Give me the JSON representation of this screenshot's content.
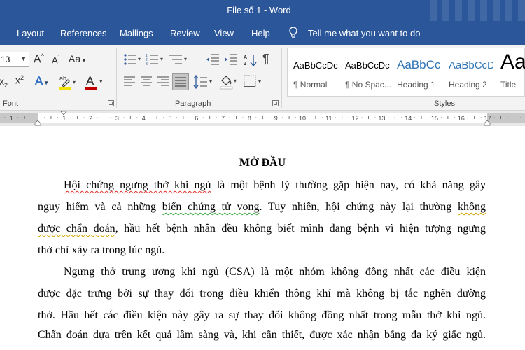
{
  "window": {
    "title": "File số 1  -  Word"
  },
  "tabs": [
    "Layout",
    "References",
    "Mailings",
    "Review",
    "View",
    "Help"
  ],
  "tell_me": "Tell me what you want to do",
  "ribbon": {
    "font": {
      "size": "13",
      "grow_label": "A",
      "shrink_label": "A",
      "case_label": "Aa",
      "subscript_label": "x",
      "subscript_sub": "2",
      "superscript_label": "x",
      "superscript_sup": "2",
      "effects_label": "A",
      "font_color_label": "A",
      "group_label": "Font"
    },
    "paragraph": {
      "group_label": "Paragraph",
      "show_marks": "¶"
    },
    "styles": {
      "group_label": "Styles",
      "items": [
        {
          "sample": "AaBbCcDc",
          "name": "¶ Normal"
        },
        {
          "sample": "AaBbCcDc",
          "name": "¶ No Spac..."
        },
        {
          "sample": "AaBbCc",
          "name": "Heading 1"
        },
        {
          "sample": "AaBbCcD",
          "name": "Heading 2"
        },
        {
          "sample": "Aa",
          "name": "Title"
        }
      ]
    }
  },
  "ruler": {
    "numbers": [
      "1",
      "1",
      "2",
      "3",
      "4",
      "5",
      "6",
      "7",
      "8",
      "9",
      "10",
      "11",
      "12",
      "13",
      "14",
      "15",
      "16",
      "17"
    ]
  },
  "document": {
    "title": "MỞ ĐẦU",
    "p1": {
      "l1_err": "Hội chứng ngưng thở khi ngủ",
      "l1_rest": " là một bệnh lý thường gặp hiện nay, có khả năng gây",
      "l2_a": "nguy hiểm và cả những ",
      "l2_err": "biến chứng tử vong",
      "l2_b": ". Tuy nhiên, hội chứng này lại thường ",
      "l2_err2": "không",
      "l3_err": "được chẩn đoán",
      "l3_rest": ", hầu hết bệnh nhân đều không biết mình đang bệnh vì hiện tượng ngưng",
      "l4": "thở chỉ xảy ra trong lúc ngủ."
    },
    "p2": {
      "l1": "Ngưng thở trung ương khi ngủ (CSA) là một nhóm không đồng nhất các điều kiện",
      "l2": "được đặc trưng bởi sự thay đổi trong điều khiển thông khí mà không bị tắc nghẽn đường",
      "l3": "thở. Hầu hết các điều kiện này gây ra sự thay đổi không đồng nhất trong mẫu thở khi ngủ.",
      "l4": "Chẩn đoán dựa trên kết quả lâm sàng và, khi cần thiết, được xác nhận bằng đa ký giấc ngủ."
    }
  },
  "colors": {
    "accent": "#2b579a",
    "ribbon_bg": "#f3f3f3",
    "highlight_yellow": "#f2e400",
    "font_red": "#c00000",
    "spell_red": "#e0302a",
    "grammar_green": "#3da640"
  }
}
